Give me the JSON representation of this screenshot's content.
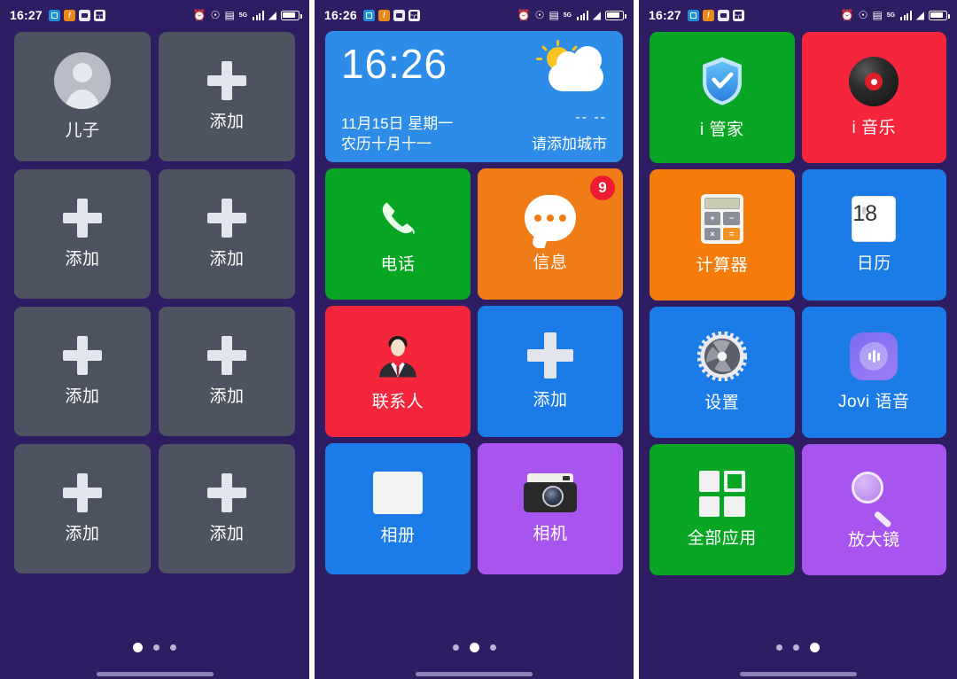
{
  "screens": [
    {
      "name": "contacts-page",
      "statusbar": {
        "time": "16:27",
        "left_icons": [
          "app-notification-icon",
          "warning-notification-icon",
          "photo-notification-icon",
          "share-notification-icon"
        ],
        "right_icons": [
          "alarm-icon",
          "vibrate-icon",
          "sd-card-icon",
          "signal-5g-icon",
          "wifi-icon",
          "battery-icon"
        ],
        "network_label": "5G"
      },
      "tiles": [
        {
          "label": "儿子",
          "icon": "avatar-icon",
          "color": "#4d5360"
        },
        {
          "label": "添加",
          "icon": "plus-icon",
          "color": "#4d5360"
        },
        {
          "label": "添加",
          "icon": "plus-icon",
          "color": "#4d5360"
        },
        {
          "label": "添加",
          "icon": "plus-icon",
          "color": "#4d5360"
        },
        {
          "label": "添加",
          "icon": "plus-icon",
          "color": "#4d5360"
        },
        {
          "label": "添加",
          "icon": "plus-icon",
          "color": "#4d5360"
        },
        {
          "label": "添加",
          "icon": "plus-icon",
          "color": "#4d5360"
        },
        {
          "label": "添加",
          "icon": "plus-icon",
          "color": "#4d5360"
        }
      ],
      "page_indicator": {
        "count": 3,
        "active": 1
      }
    },
    {
      "name": "home-page",
      "statusbar": {
        "time": "16:26",
        "left_icons": [
          "app-notification-icon",
          "warning-notification-icon",
          "photo-notification-icon",
          "share-notification-icon"
        ],
        "right_icons": [
          "alarm-icon",
          "vibrate-icon",
          "sd-card-icon",
          "signal-5g-icon",
          "wifi-icon",
          "battery-icon"
        ],
        "network_label": "5G"
      },
      "widget": {
        "time": "16:26",
        "date": "11月15日  星期一",
        "lunar": "农历十月十一",
        "temperature": "-- --",
        "city_hint": "请添加城市",
        "weather_icon": "sun-cloud-icon",
        "color": "#2d8ce8"
      },
      "tiles": [
        {
          "label": "电话",
          "icon": "phone-icon",
          "color": "#09a626",
          "badge": ""
        },
        {
          "label": "信息",
          "icon": "message-bubble-icon",
          "color": "#f07c18",
          "badge": "9"
        },
        {
          "label": "联系人",
          "icon": "person-suit-icon",
          "color": "#f5263c",
          "badge": ""
        },
        {
          "label": "添加",
          "icon": "plus-icon",
          "color": "#1b7ce8",
          "badge": ""
        },
        {
          "label": "相册",
          "icon": "album-icon",
          "color": "#1b7ce8",
          "badge": ""
        },
        {
          "label": "相机",
          "icon": "camera-icon",
          "color": "#a855f0",
          "badge": ""
        }
      ],
      "page_indicator": {
        "count": 3,
        "active": 2
      }
    },
    {
      "name": "apps-page",
      "statusbar": {
        "time": "16:27",
        "left_icons": [
          "app-notification-icon",
          "warning-notification-icon",
          "photo-notification-icon",
          "share-notification-icon"
        ],
        "right_icons": [
          "alarm-icon",
          "vibrate-icon",
          "sd-card-icon",
          "signal-5g-icon",
          "wifi-icon",
          "battery-icon"
        ],
        "network_label": "5G"
      },
      "tiles": [
        {
          "label": "i 管家",
          "icon": "shield-check-icon",
          "color": "#09a626"
        },
        {
          "label": "i 音乐",
          "icon": "vinyl-record-icon",
          "color": "#f5263c"
        },
        {
          "label": "计算器",
          "icon": "calculator-icon",
          "color": "#f57c0a"
        },
        {
          "label": "日历",
          "icon": "calendar-icon",
          "color": "#1b7ce8",
          "calendar_day": "18"
        },
        {
          "label": "设置",
          "icon": "gear-icon",
          "color": "#1b7ce8"
        },
        {
          "label": "Jovi 语音",
          "icon": "jovi-voice-icon",
          "color": "#1b7ce8"
        },
        {
          "label": "全部应用",
          "icon": "all-apps-grid-icon",
          "color": "#09a626"
        },
        {
          "label": "放大镜",
          "icon": "magnifier-icon",
          "color": "#a855f0"
        }
      ],
      "page_indicator": {
        "count": 3,
        "active": 3
      }
    }
  ],
  "theme": {
    "background": "#2e1d63",
    "tile_placeholder": "#4d5360",
    "badge_red": "#ec1c32",
    "dot_active": "#ffffff",
    "dot_inactive": "#b9b3d6"
  }
}
